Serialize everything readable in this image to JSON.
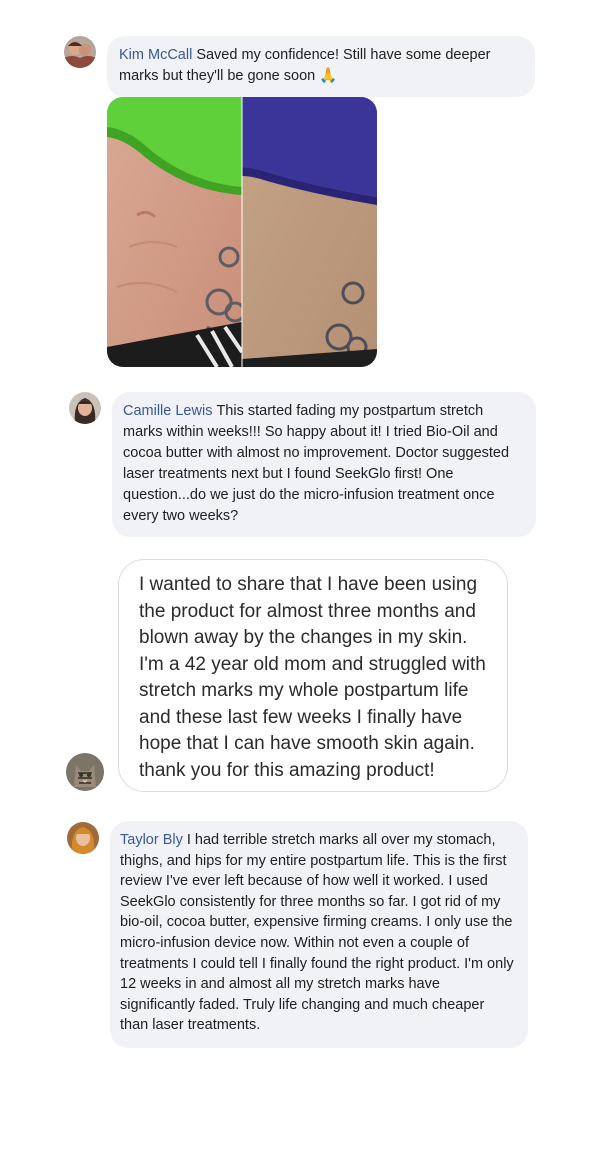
{
  "comments": [
    {
      "author": "Kim McCall",
      "text": "Saved my confidence! Still have some deeper marks but they'll be gone soon 🙏"
    },
    {
      "author": "Camille Lewis",
      "text": "This started fading my postpartum stretch marks within weeks!!! So happy about it! I tried Bio-Oil and cocoa butter with almost no improvement. Doctor suggested laser treatments next but I found SeekGlo first! One question...do we just do the micro-infusion treatment once every two weeks?"
    },
    {
      "author": "",
      "text": "I wanted to share that I have been using the product for almost three months and blown away by the changes in my skin. I'm a 42 year old mom and struggled with stretch marks my whole postpartum life and these last few weeks I finally have hope that I can have smooth skin again. thank you for this amazing product!"
    },
    {
      "author": "Taylor Bly",
      "text": "I had terrible stretch marks all over my stomach, thighs, and hips for my entire postpartum life. This is the first review I've ever left because of how well it worked. I used SeekGlo consistently for three months so far. I got rid of my bio-oil, cocoa butter, expensive firming creams. I only use the micro-infusion device now. Within not even a couple of treatments I could tell I finally found the right product. I'm only 12 weeks in and almost all my stretch marks have significantly faded. Truly life changing and much cheaper than laser treatments."
    }
  ],
  "colors": {
    "author_link": "#385898",
    "bubble_bg": "#f0f2f5"
  }
}
